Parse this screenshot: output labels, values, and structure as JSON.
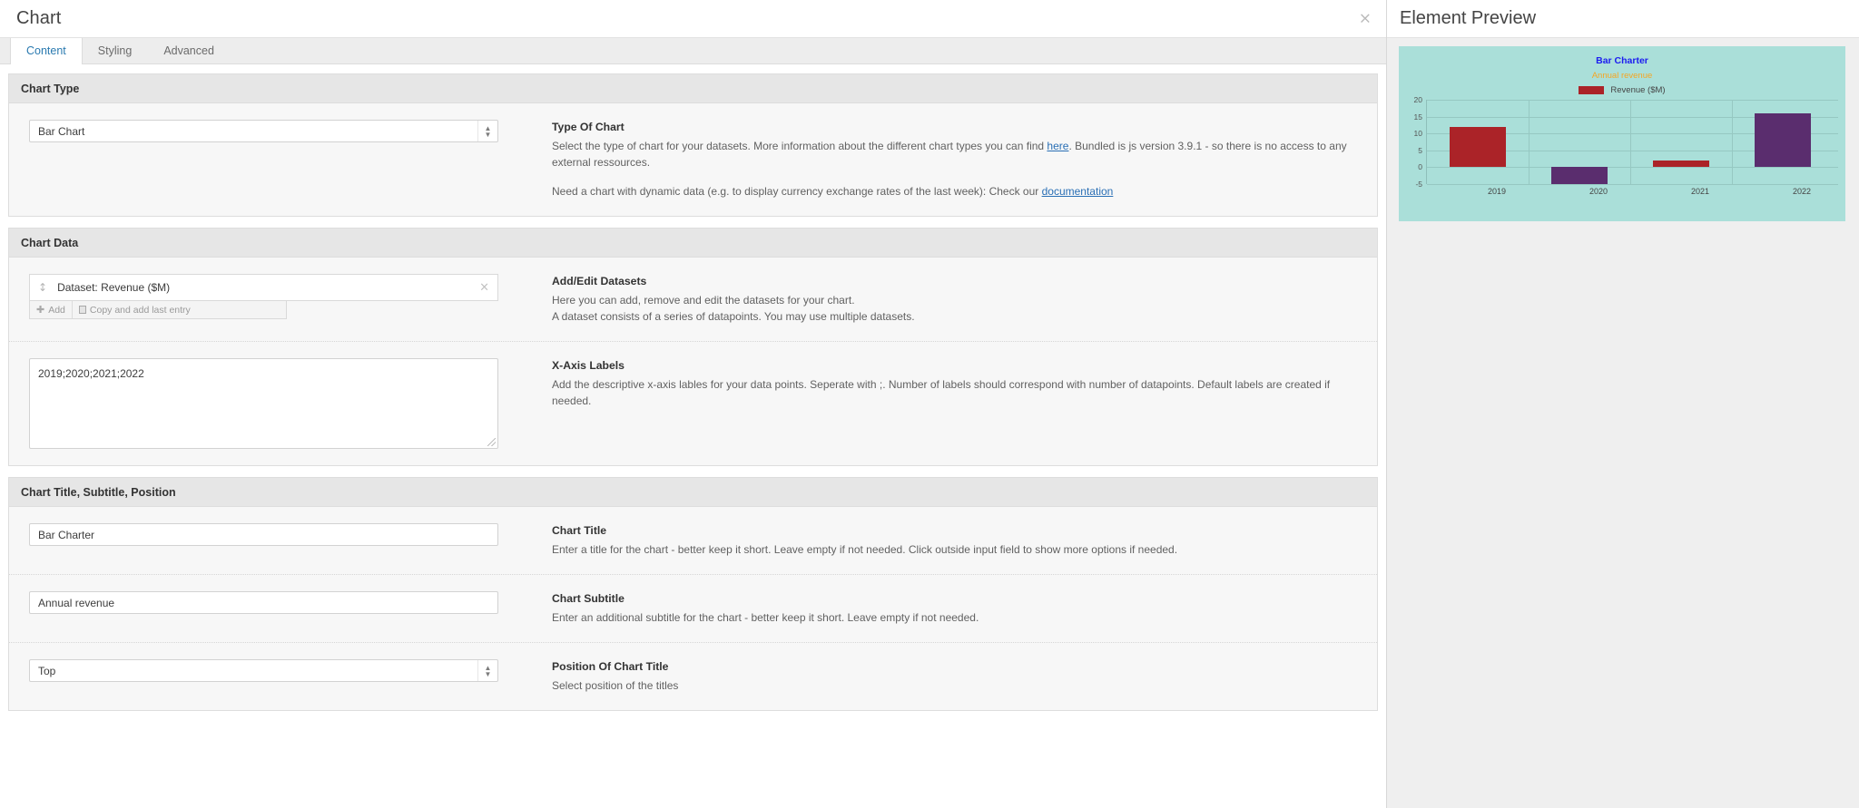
{
  "editor": {
    "title": "Chart",
    "close_icon": "×",
    "tabs": [
      {
        "label": "Content",
        "active": true
      },
      {
        "label": "Styling",
        "active": false
      },
      {
        "label": "Advanced",
        "active": false
      }
    ],
    "panels": {
      "chart_type": {
        "heading": "Chart Type",
        "select_value": "Bar Chart",
        "help_label": "Type Of Chart",
        "help_line1_a": "Select the type of chart for your datasets. More information about the different chart types you can find ",
        "help_link1": "here",
        "help_line1_b": ". Bundled is js version 3.9.1 - so there is no access to any external ressources.",
        "help_line2_a": "Need a chart with dynamic data (e.g. to display currency exchange rates of the last week): Check our ",
        "help_link2": "documentation"
      },
      "chart_data": {
        "heading": "Chart Data",
        "dataset_name": "Dataset: Revenue ($M)",
        "dataset_remove_icon": "×",
        "drag_handle_icon": "↕",
        "add_button": "Add",
        "copy_button": "Copy and add last entry",
        "datasets_label": "Add/Edit Datasets",
        "datasets_desc1": "Here you can add, remove and edit the datasets for your chart.",
        "datasets_desc2": "A dataset consists of a series of datapoints. You may use multiple datasets.",
        "xaxis_value": "2019;2020;2021;2022",
        "xaxis_label": "X-Axis Labels",
        "xaxis_desc": "Add the descriptive x-axis lables for your data points. Seperate with ;. Number of labels should correspond with number of datapoints. Default labels are created if needed."
      },
      "title_panel": {
        "heading": "Chart Title, Subtitle, Position",
        "title_value": "Bar Charter",
        "title_label": "Chart Title",
        "title_desc": "Enter a title for the chart - better keep it short. Leave empty if not needed. Click outside input field to show more options if needed.",
        "subtitle_value": "Annual revenue",
        "subtitle_label": "Chart Subtitle",
        "subtitle_desc": "Enter an additional subtitle for the chart - better keep it short. Leave empty if not needed.",
        "position_value": "Top",
        "position_label": "Position Of Chart Title",
        "position_desc": "Select position of the titles"
      }
    }
  },
  "preview": {
    "title": "Element Preview"
  },
  "chart_data": {
    "type": "bar",
    "title": "Bar Charter",
    "subtitle": "Annual revenue",
    "categories": [
      "2019",
      "2020",
      "2021",
      "2022"
    ],
    "values": [
      12,
      -5,
      2,
      16
    ],
    "bar_colors": [
      "#ab2328",
      "#5a2d6e",
      "#ab2328",
      "#5a2d6e"
    ],
    "series": [
      {
        "name": "Revenue ($M)",
        "values": [
          12,
          -5,
          2,
          16
        ]
      }
    ],
    "legend": [
      "Revenue ($M)"
    ],
    "legend_color": "#ab2328",
    "legend_position": "top",
    "title_color": "#1c1cf0",
    "subtitle_color": "#f5a623",
    "plot_background": "#aadfd9",
    "grid_color": "#96c8c2",
    "yticks": [
      20,
      15,
      10,
      5,
      0,
      -5
    ],
    "ylim": [
      -5,
      20
    ],
    "xlabel": "",
    "ylabel": "",
    "grid": true
  }
}
